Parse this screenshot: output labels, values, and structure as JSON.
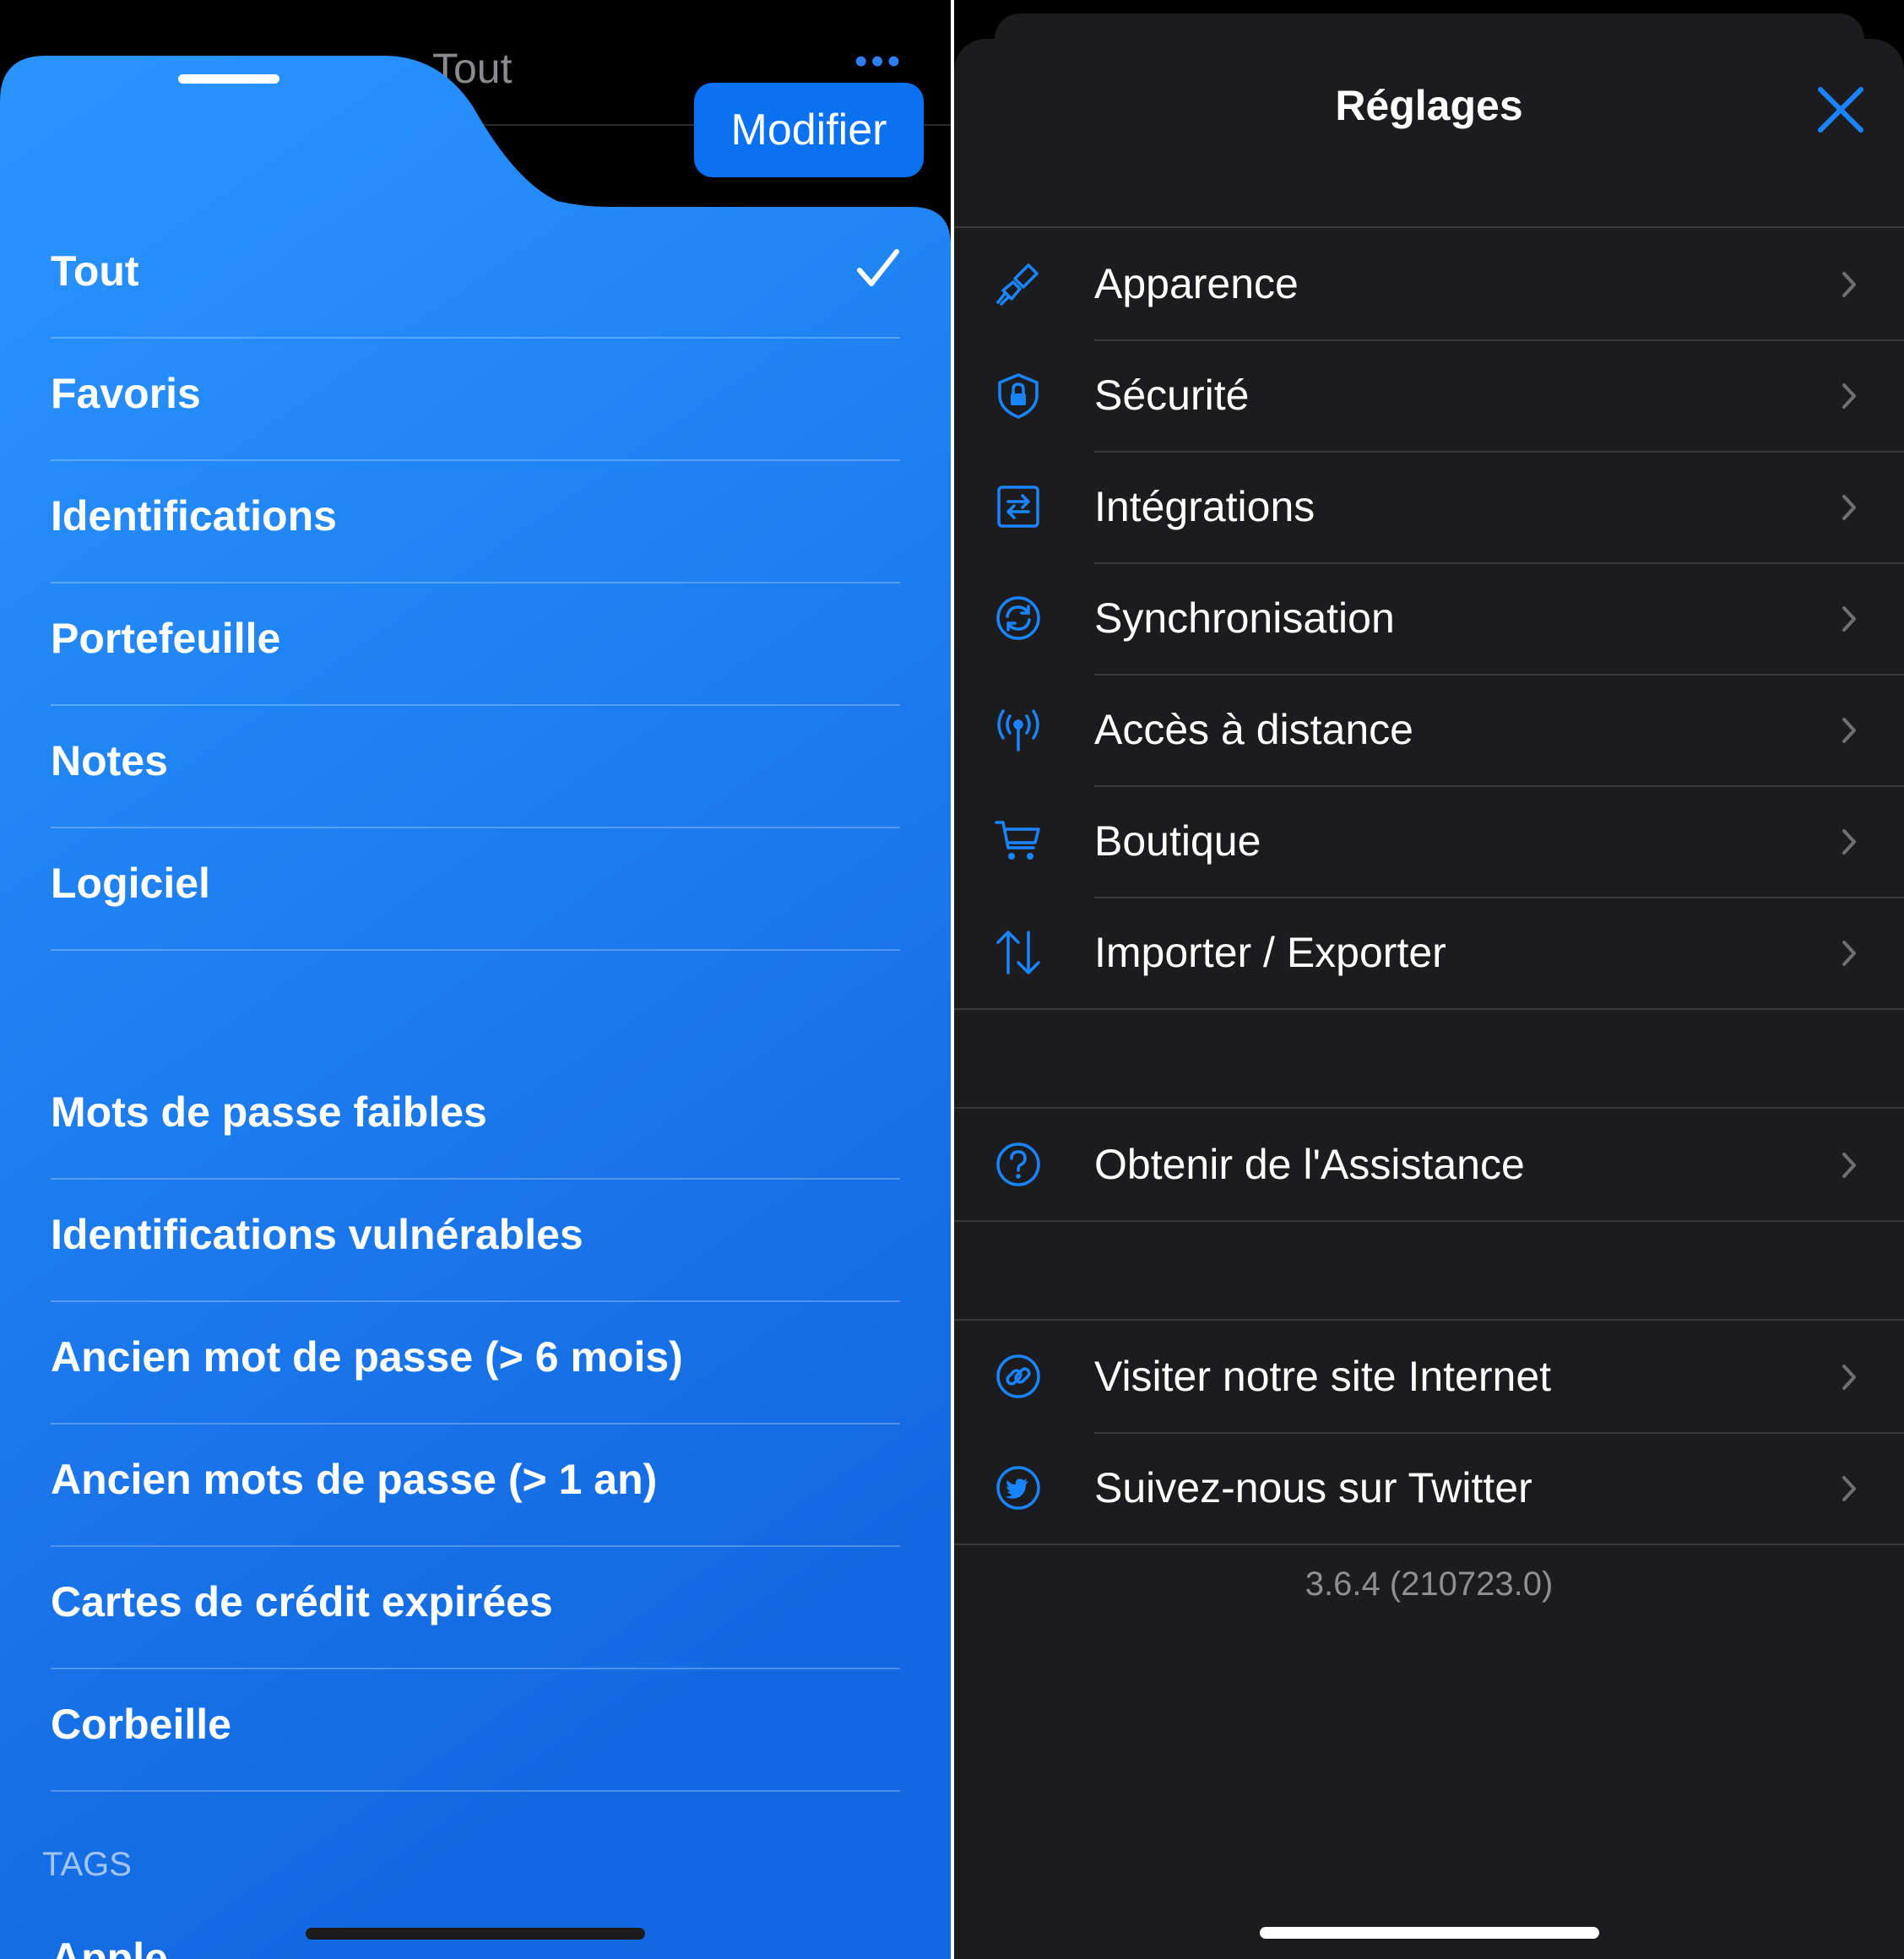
{
  "left": {
    "background_title": "Tout",
    "background_dots": "•••",
    "edit_button": "Modifier",
    "filters": [
      "Tout",
      "Favoris",
      "Identifications",
      "Portefeuille",
      "Notes",
      "Logiciel"
    ],
    "selected_filter": "Tout",
    "smart_filters": [
      "Mots de passe faibles",
      "Identifications vulnérables",
      "Ancien mot de passe (> 6 mois)",
      "Ancien mots de passe (> 1 an)",
      "Cartes de crédit expirées",
      "Corbeille"
    ],
    "tags_header": "TAGS",
    "partial_tag": "Apple"
  },
  "settings": {
    "title": "Réglages",
    "main_items": [
      {
        "label": "Apparence",
        "icon": "paintbrush-icon"
      },
      {
        "label": "Sécurité",
        "icon": "shield-lock-icon"
      },
      {
        "label": "Intégrations",
        "icon": "integration-arrows-icon"
      },
      {
        "label": "Synchronisation",
        "icon": "sync-icon"
      },
      {
        "label": "Accès à distance",
        "icon": "antenna-icon"
      },
      {
        "label": "Boutique",
        "icon": "cart-icon"
      },
      {
        "label": "Importer / Exporter",
        "icon": "import-export-icon"
      }
    ],
    "support_item": {
      "label": "Obtenir de l'Assistance",
      "icon": "question-icon"
    },
    "web_items": [
      {
        "label": "Visiter notre site Internet",
        "icon": "link-icon"
      },
      {
        "label": "Suivez-nous sur Twitter",
        "icon": "twitter-icon"
      }
    ],
    "version": "3.6.4 (210723.0)"
  },
  "colors": {
    "accent": "#1a84ff",
    "sheet_blue_top": "#2a93ff",
    "sheet_blue_bottom": "#1269e0",
    "settings_bg": "#1c1c1e"
  }
}
